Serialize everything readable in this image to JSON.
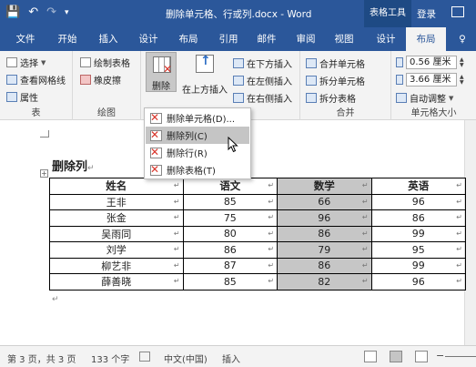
{
  "titlebar": {
    "title": "删除单元格、行或列.docx - Word",
    "context_tools": "表格工具",
    "login": "登录",
    "save_glyph": "💾",
    "undo_glyph": "↶",
    "redo_glyph": "↷",
    "more_glyph": "▾"
  },
  "tabs": [
    "文件",
    "开始",
    "插入",
    "设计",
    "布局",
    "引用",
    "邮件",
    "审阅",
    "视图",
    "设计",
    "布局",
    "♀"
  ],
  "active_tab_index": 10,
  "ribbon": {
    "table_group": {
      "select": "选择",
      "gridlines": "查看网格线",
      "properties": "属性",
      "label": "表"
    },
    "draw_group": {
      "draw_table": "绘制表格",
      "eraser": "橡皮擦",
      "label": "绘图"
    },
    "rows_cols_group": {
      "delete": "删除",
      "insert_above": "在上方插入",
      "insert_below": "在下方插入",
      "insert_left": "在左侧插入",
      "insert_right": "在右侧插入"
    },
    "merge_group": {
      "merge_cells": "合并单元格",
      "split_cells": "拆分单元格",
      "split_table": "拆分表格",
      "label": "合并"
    },
    "cell_size_group": {
      "height": "0.56 厘米",
      "width": "3.66 厘米",
      "autofit": "自动调整",
      "label": "单元格大小"
    }
  },
  "dropdown": {
    "items": [
      "删除单元格(D)...",
      "删除列(C)",
      "删除行(R)",
      "删除表格(T)"
    ],
    "hover_index": 1
  },
  "document": {
    "heading": "删除列",
    "table": {
      "headers": [
        "姓名",
        "语文",
        "数学",
        "英语"
      ],
      "rows": [
        [
          "王非",
          "85",
          "66",
          "96"
        ],
        [
          "张金",
          "75",
          "96",
          "86"
        ],
        [
          "吴雨同",
          "80",
          "86",
          "99"
        ],
        [
          "刘学",
          "86",
          "79",
          "95"
        ],
        [
          "柳艺非",
          "87",
          "86",
          "99"
        ],
        [
          "薛善晓",
          "85",
          "82",
          "96"
        ]
      ],
      "selected_column_index": 2
    }
  },
  "statusbar": {
    "page": "第 3 页，共 3 页",
    "words": "133 个字",
    "language": "中文(中国)",
    "mode": "插入"
  }
}
